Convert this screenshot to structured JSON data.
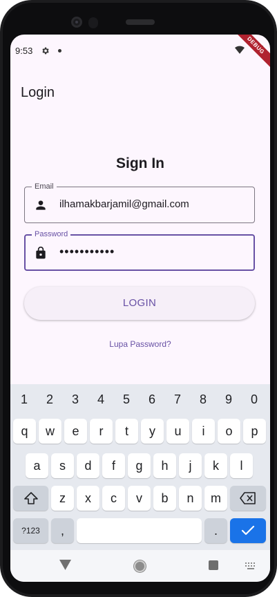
{
  "status_bar": {
    "time": "9:53",
    "debug_banner": "DEBUG"
  },
  "app_bar": {
    "title": "Login"
  },
  "form": {
    "heading": "Sign In",
    "email": {
      "label": "Email",
      "value": "ilhamakbarjamil@gmail.com"
    },
    "password": {
      "label": "Password",
      "value": "•••••••••••"
    },
    "login_button": "LOGIN",
    "forgot_link": "Lupa Password?"
  },
  "keyboard": {
    "number_row": [
      "1",
      "2",
      "3",
      "4",
      "5",
      "6",
      "7",
      "8",
      "9",
      "0"
    ],
    "row1": [
      "q",
      "w",
      "e",
      "r",
      "t",
      "y",
      "u",
      "i",
      "o",
      "p"
    ],
    "row2": [
      "a",
      "s",
      "d",
      "f",
      "g",
      "h",
      "j",
      "k",
      "l"
    ],
    "row3": [
      "z",
      "x",
      "c",
      "v",
      "b",
      "n",
      "m"
    ],
    "symbols_key": "?123",
    "comma_key": ",",
    "period_key": ".",
    "icons": {
      "shift": "shift-icon",
      "backspace": "backspace-icon",
      "done": "check-icon"
    }
  },
  "colors": {
    "primary": "#6750a4",
    "screen_background": "#fdf6fe",
    "keyboard_background": "#e6e9ef",
    "done_key": "#1a73e8",
    "debug_banner": "#b0222f"
  }
}
